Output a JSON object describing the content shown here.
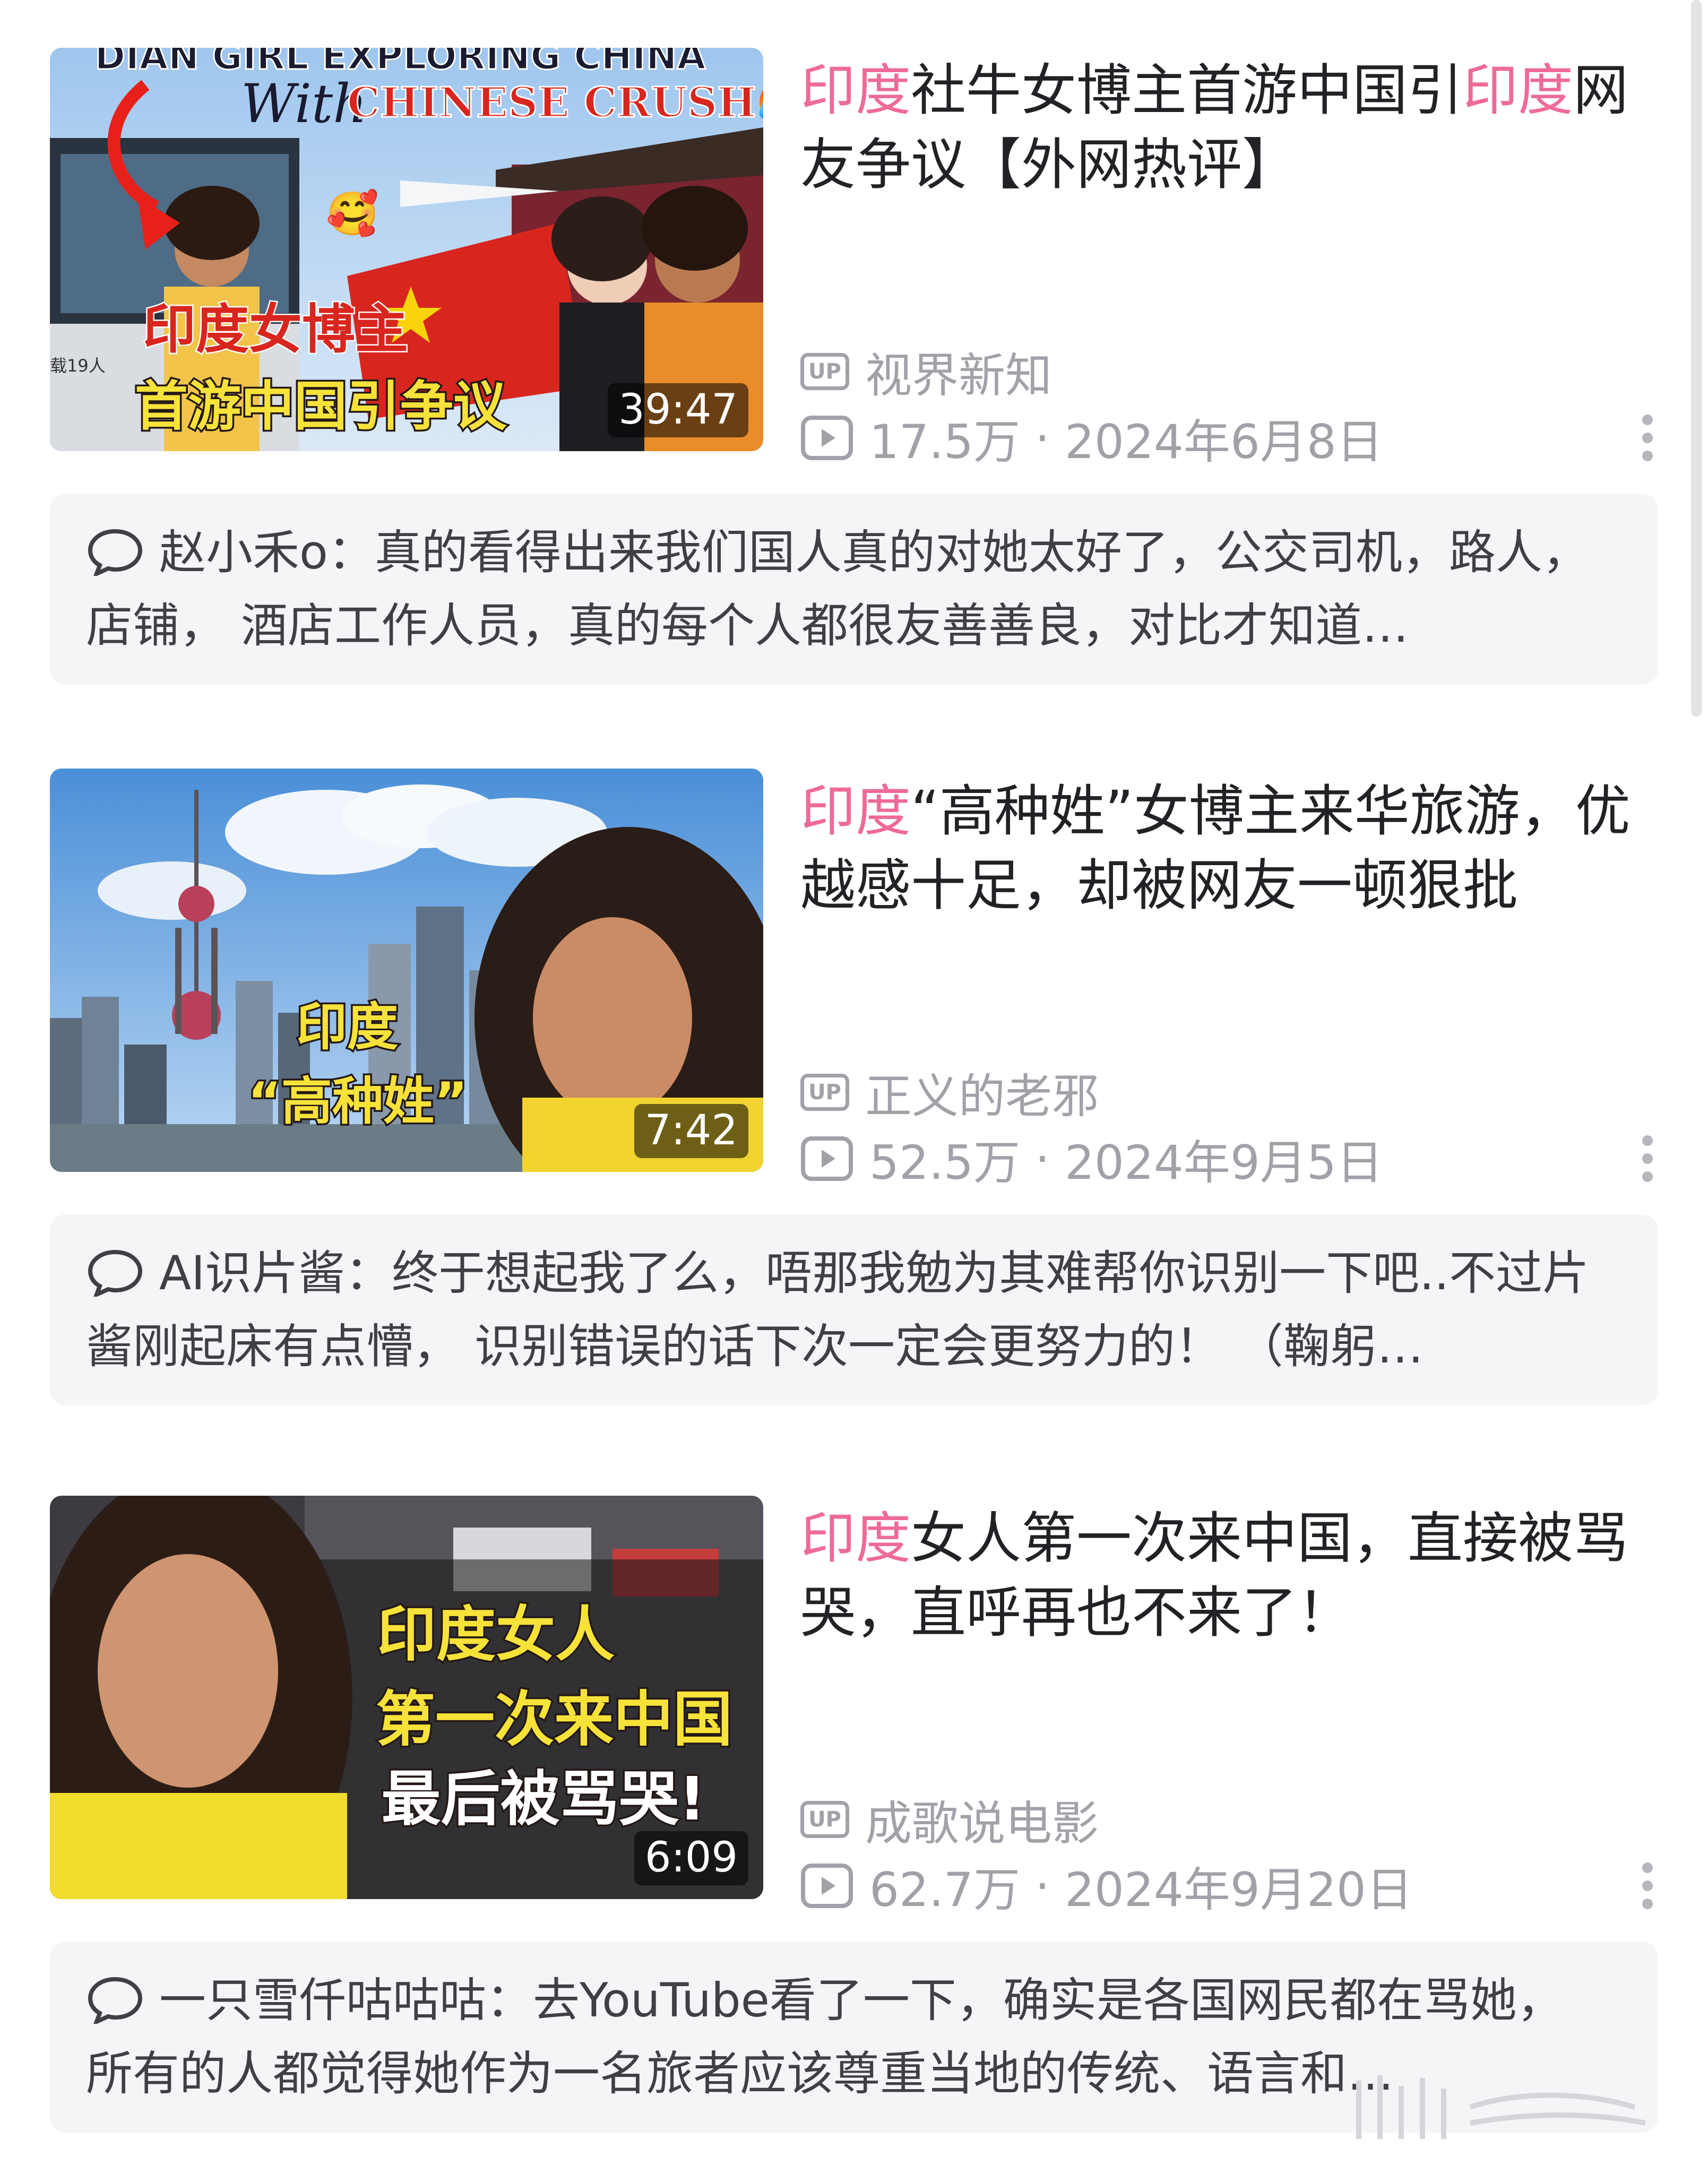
{
  "items": [
    {
      "title_keyword": "印度",
      "title_part1": "社牛女博主首游中国引",
      "title_keyword2": "印度",
      "title_part2": "网友争议【外网热评】",
      "thumbnail": {
        "top_text": "DIAN GIRL EXPLORING CHINA",
        "script_text": "With",
        "sub_text": "CHINESE CRUSH🥵",
        "emoji": "🥰",
        "bus_text": "载19人",
        "overlay_line1": "印度女博主",
        "overlay_line2": "首游中国引争议"
      },
      "duration": "39:47",
      "uploader": "视界新知",
      "views": "17.5万",
      "date": "2024年6月8日",
      "comment": "赵小禾o：真的看得出来我们国人真的对她太好了，公交司机，路人，店铺， 酒店工作人员，真的每个人都很友善善良，对比才知道…"
    },
    {
      "title_keyword": "印度",
      "title_part1": "“高种姓”女博主来华旅游，优越感十足，却被网友一顿狠批",
      "thumbnail": {
        "overlay_line1": "印度",
        "overlay_line2": "“高种姓”"
      },
      "duration": "7:42",
      "uploader": "正义的老邪",
      "views": "52.5万",
      "date": "2024年9月5日",
      "comment": "AI识片酱：终于想起我了么，唔那我勉为其难帮你识别一下吧..不过片酱刚起床有点懵， 识别错误的话下次一定会更努力的！ （鞠躬…"
    },
    {
      "title_keyword": "印度",
      "title_part1": "女人第一次来中国，直接被骂哭，直呼再也不来了！",
      "thumbnail": {
        "overlay_line1": "印度女人",
        "overlay_line2": "第一次来中国",
        "overlay_line3": "最后被骂哭!"
      },
      "duration": "6:09",
      "uploader": "成歌说电影",
      "views": "62.7万",
      "date": "2024年9月20日",
      "comment": "一只雪仟咕咕咕：去YouTube看了一下，确实是各国网民都在骂她， 所有的人都觉得她作为一名旅者应该尊重当地的传统、语言和…"
    }
  ],
  "labels": {
    "up": "UP",
    "separator": "·"
  },
  "colors": {
    "keyword": "#ee6a98",
    "meta": "#a1a1a8",
    "comment_bg": "#f5f5f7"
  }
}
